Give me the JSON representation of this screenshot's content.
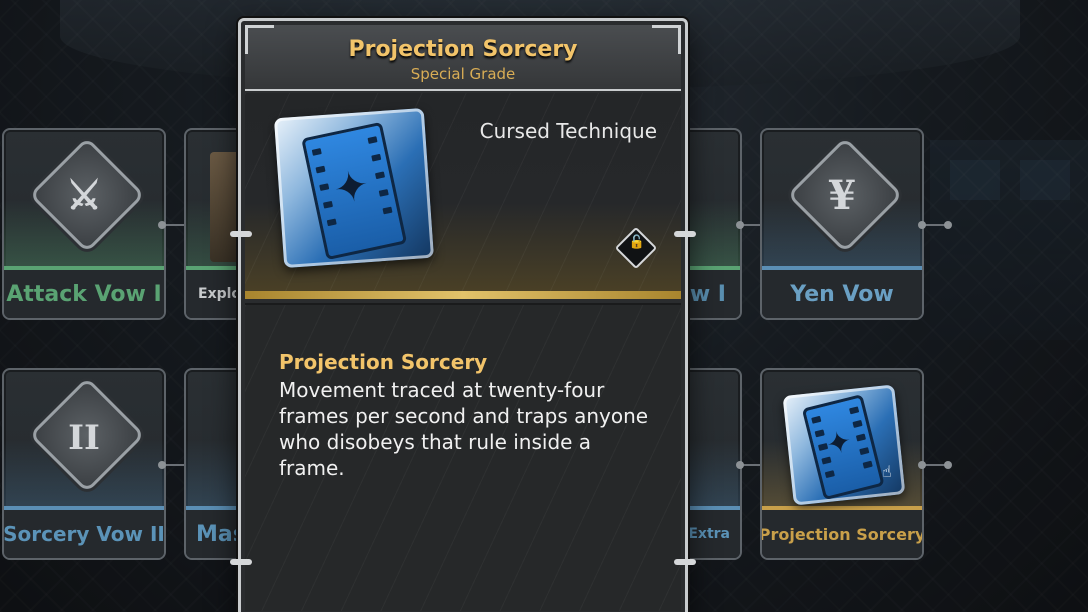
{
  "popup": {
    "title": "Projection Sorcery",
    "grade": "Special Grade",
    "type": "Cursed Technique",
    "icon": "film-strip-icon",
    "lock_icon": "unlock-icon",
    "description_title": "Projection Sorcery",
    "description": "Movement traced at twenty-four frames per second and traps anyone who disobeys that rule inside a frame."
  },
  "vows": [
    {
      "label": "Attack Vow I",
      "icon": "crossed-swords-icon",
      "color": "#5aa373"
    },
    {
      "label": "Exploc",
      "icon": "explosion-icon",
      "color": "#c9ccce"
    },
    {
      "label": "w I",
      "icon": "diamond-icon",
      "color": "#5a8fb0"
    },
    {
      "label": "Yen Vow",
      "icon": "yen-icon",
      "color": "#6aa0c4"
    },
    {
      "label": "Sorcery Vow II",
      "icon": "roman-two-icon",
      "color": "#5b93b8"
    },
    {
      "label": "Mas",
      "icon": "diamond-icon",
      "color": "#5b93b8"
    },
    {
      "label": "Extra",
      "icon": "diamond-icon",
      "color": "#5b93b8"
    },
    {
      "label": "Projection Sorcery",
      "icon": "film-strip-icon",
      "color": "#c9a04a"
    }
  ],
  "glyphs": {
    "attack": "⚔",
    "yen": "¥",
    "two": "II",
    "sparkle": "✦",
    "lock": "🔓",
    "cursor": "☝"
  }
}
